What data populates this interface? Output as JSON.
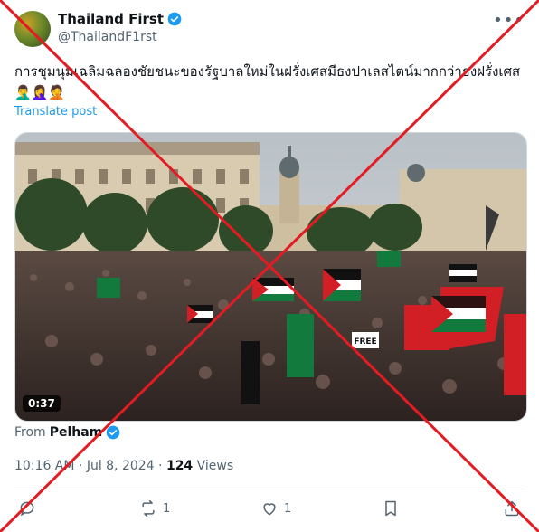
{
  "account": {
    "display_name": "Thailand First",
    "handle": "@ThailandF1rst"
  },
  "post": {
    "text": "การชุมนุมเฉลิมฉลองชัยชนะของรัฐบาลใหม่ในฝรั่งเศสมีธงปาเลสไตน์มากกว่าธงฝรั่งเศส 🤦‍♂️🤦‍♀️🤦",
    "translate_label": "Translate post",
    "video_duration": "0:37",
    "video_banner": "FREE",
    "from_prefix": "From",
    "from_name": "Pelham",
    "time": "10:16 AM",
    "date": "Jul 8, 2024",
    "views_count": "124",
    "views_label": "Views"
  },
  "actions": {
    "replies": "",
    "reposts": "1",
    "likes": "1"
  },
  "colors": {
    "link": "#1d9bf0",
    "cross": "#e31b23"
  }
}
